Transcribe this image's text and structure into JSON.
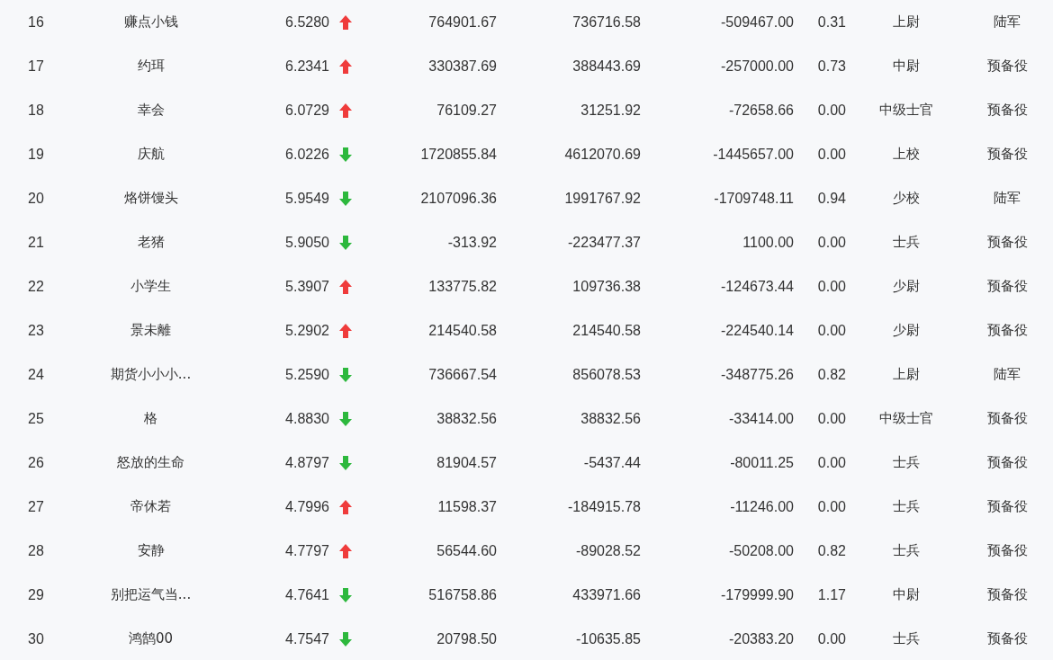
{
  "rows": [
    {
      "index": "16",
      "name": "赚点小钱",
      "value": "6.5280",
      "kind": "up",
      "column_4": "764901.67",
      "column_5": "736716.58",
      "column_6": "-509467.00",
      "column_7": "0.31",
      "rank": "上尉",
      "branch": "陆军"
    },
    {
      "index": "17",
      "name": "约珥",
      "value": "6.2341",
      "kind": "up",
      "column_4": "330387.69",
      "column_5": "388443.69",
      "column_6": "-257000.00",
      "column_7": "0.73",
      "rank": "中尉",
      "branch": "预备役"
    },
    {
      "index": "18",
      "name": "幸会",
      "value": "6.0729",
      "kind": "up",
      "column_4": "76109.27",
      "column_5": "31251.92",
      "column_6": "-72658.66",
      "column_7": "0.00",
      "rank": "中级士官",
      "branch": "预备役"
    },
    {
      "index": "19",
      "name": "庆航",
      "value": "6.0226",
      "kind": "down",
      "column_4": "1720855.84",
      "column_5": "4612070.69",
      "column_6": "-1445657.00",
      "column_7": "0.00",
      "rank": "上校",
      "branch": "预备役"
    },
    {
      "index": "20",
      "name": "烙饼馒头",
      "value": "5.9549",
      "kind": "down",
      "column_4": "2107096.36",
      "column_5": "1991767.92",
      "column_6": "-1709748.11",
      "column_7": "0.94",
      "rank": "少校",
      "branch": "陆军"
    },
    {
      "index": "21",
      "name": "老猪",
      "value": "5.9050",
      "kind": "down",
      "column_4": "-313.92",
      "column_5": "-223477.37",
      "column_6": "1100.00",
      "column_7": "0.00",
      "rank": "士兵",
      "branch": "预备役"
    },
    {
      "index": "22",
      "name": "小学生",
      "value": "5.3907",
      "kind": "up",
      "column_4": "133775.82",
      "column_5": "109736.38",
      "column_6": "-124673.44",
      "column_7": "0.00",
      "rank": "少尉",
      "branch": "预备役"
    },
    {
      "index": "23",
      "name": "景未離",
      "value": "5.2902",
      "kind": "up",
      "column_4": "214540.58",
      "column_5": "214540.58",
      "column_6": "-224540.14",
      "column_7": "0.00",
      "rank": "少尉",
      "branch": "预备役"
    },
    {
      "index": "24",
      "name": "期货小小小...",
      "value": "5.2590",
      "kind": "down",
      "column_4": "736667.54",
      "column_5": "856078.53",
      "column_6": "-348775.26",
      "column_7": "0.82",
      "rank": "上尉",
      "branch": "陆军"
    },
    {
      "index": "25",
      "name": "格",
      "value": "4.8830",
      "kind": "down",
      "column_4": "38832.56",
      "column_5": "38832.56",
      "column_6": "-33414.00",
      "column_7": "0.00",
      "rank": "中级士官",
      "branch": "预备役"
    },
    {
      "index": "26",
      "name": "怒放的生命",
      "value": "4.8797",
      "kind": "down",
      "column_4": "81904.57",
      "column_5": "-5437.44",
      "column_6": "-80011.25",
      "column_7": "0.00",
      "rank": "士兵",
      "branch": "预备役"
    },
    {
      "index": "27",
      "name": "帝休若",
      "value": "4.7996",
      "kind": "up",
      "column_4": "11598.37",
      "column_5": "-184915.78",
      "column_6": "-11246.00",
      "column_7": "0.00",
      "rank": "士兵",
      "branch": "预备役"
    },
    {
      "index": "28",
      "name": "安静",
      "value": "4.7797",
      "kind": "up",
      "column_4": "56544.60",
      "column_5": "-89028.52",
      "column_6": "-50208.00",
      "column_7": "0.82",
      "rank": "士兵",
      "branch": "预备役"
    },
    {
      "index": "29",
      "name": "别把运气当...",
      "value": "4.7641",
      "kind": "down",
      "column_4": "516758.86",
      "column_5": "433971.66",
      "column_6": "-179999.90",
      "column_7": "1.17",
      "rank": "中尉",
      "branch": "预备役"
    },
    {
      "index": "30",
      "name": "鸿鹄00",
      "value": "4.7547",
      "kind": "down",
      "column_4": "20798.50",
      "column_5": "-10635.85",
      "column_6": "-20383.20",
      "column_7": "0.00",
      "rank": "士兵",
      "branch": "预备役"
    }
  ]
}
